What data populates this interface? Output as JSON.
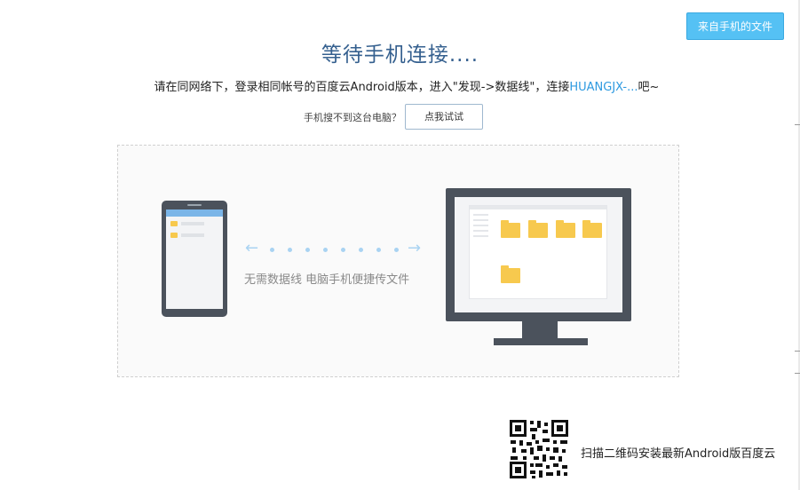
{
  "header": {
    "from_phone_button": "来自手机的文件"
  },
  "main": {
    "title": "等待手机连接....",
    "instruction_prefix": "请在同网络下，登录相同帐号的百度云Android版本，进入\"发现->数据线\"，连接",
    "device_name": "HUANGJX-...",
    "instruction_suffix": "吧~",
    "help_question": "手机搜不到这台电脑？",
    "try_button": "点我试试"
  },
  "illustration": {
    "caption": "无需数据线 电脑手机便捷传文件"
  },
  "footer": {
    "qr_caption": "扫描二维码安装最新Android版百度云"
  },
  "colors": {
    "accent": "#55c1f4",
    "title": "#35608f",
    "link": "#2e9ae0",
    "device": "#4b525c",
    "folder": "#f7c94e"
  }
}
